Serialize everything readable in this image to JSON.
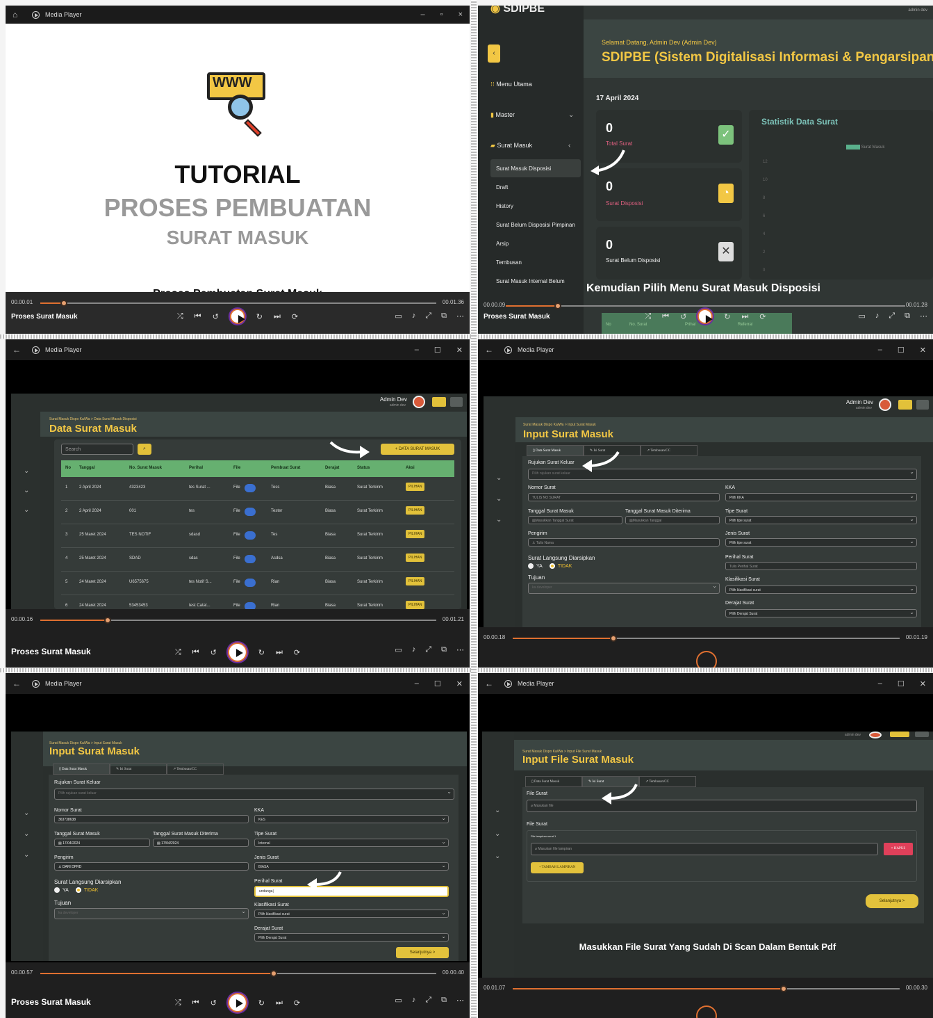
{
  "p1": {
    "title": "Media Player",
    "www_label": "WWW",
    "heading1": "TUTORIAL",
    "heading2": "PROSES PEMBUATAN",
    "heading3": "SURAT MASUK",
    "subtitle": "Proses Pembuatan Surat Masuk",
    "time_start": "00.00.01",
    "time_end": "00.01.36",
    "progress": 0.06,
    "media_title": "Proses Surat Masuk"
  },
  "p2": {
    "logo": "SDIPBE",
    "welcome": "Selamat Datang, Admin Dev (Admin Dev)",
    "app_title": "SDIPBE (Sistem Digitalisasi Informasi & Pengarsipan Berbasis",
    "date": "17 April 2024",
    "top_right": "admin dev",
    "menu": [
      "Menu Utama",
      "Master",
      "Surat Masuk"
    ],
    "submenu": [
      "Surat Masuk Disposisi",
      "Draft",
      "History",
      "Surat Belum Disposisi Pimpinan",
      "Arsip",
      "Tembusan",
      "Surat Masuk Internal Belum"
    ],
    "cards": [
      {
        "value": "0",
        "label": "Total Surat"
      },
      {
        "value": "0",
        "label": "Surat Disposisi"
      },
      {
        "value": "0",
        "label": "Surat Belum Disposisi"
      }
    ],
    "stat_title": "Statistik Data Surat",
    "legend": "Surat Masuk",
    "yticks": [
      "12",
      "10",
      "8",
      "6",
      "4",
      "2",
      "0"
    ],
    "subtitle": "Kemudian Pilih Menu Surat Masuk Disposisi",
    "table_headers": [
      "No",
      "No. Surat",
      "Prihal",
      "Referral"
    ],
    "time_start": "00.00.09",
    "time_end": "00.01.28",
    "progress": 0.13,
    "media_title": "Proses Surat Masuk",
    "colors": {
      "accent": "#f2c744",
      "green_check": "#7cc27c"
    }
  },
  "p3": {
    "title": "Media Player",
    "user": "Admin Dev",
    "user_sub": "admin dev",
    "crumb": "Surat Masuk Dispo Ka/Wa > Data Surat Masuk Disposisi",
    "page_title": "Data Surat Masuk",
    "search_placeholder": "Search",
    "add_button": "+ DATA SURAT MASUK",
    "headers": [
      "No",
      "Tanggal",
      "No. Surat Masuk",
      "Perihal",
      "File",
      "Pembuat Surat",
      "Derajat",
      "Status",
      "Aksi"
    ],
    "rows": [
      [
        "1",
        "2 April 2024",
        "4323423",
        "tes Surat ...",
        "File",
        "Tess",
        "Biasa",
        "Surat Terkirim",
        "PILIHAN"
      ],
      [
        "2",
        "2 April 2024",
        "001",
        "tes",
        "File",
        "Tester",
        "Biasa",
        "Surat Terkirim",
        "PILIHAN"
      ],
      [
        "3",
        "25 Maret 2024",
        "TES NOTIF",
        "sdasd",
        "File",
        "Tes",
        "Biasa",
        "Surat Terkirim",
        "PILIHAN"
      ],
      [
        "4",
        "25 Maret 2024",
        "SDAD",
        "sdas",
        "File",
        "Asdsa",
        "Biasa",
        "Surat Terkirim",
        "PILIHAN"
      ],
      [
        "5",
        "24 Maret 2024",
        "U6575675",
        "tes Notif S...",
        "File",
        "Rian",
        "Biasa",
        "Surat Terkirim",
        "PILIHAN"
      ],
      [
        "6",
        "24 Maret 2024",
        "53453453",
        "test Catat...",
        "File",
        "Rian",
        "Biasa",
        "Surat Terkirim",
        "PILIHAN"
      ]
    ],
    "time_start": "00.00.16",
    "time_end": "00.01.21",
    "progress": 0.17,
    "media_title": "Proses Surat Masuk"
  },
  "p4": {
    "title": "Media Player",
    "user": "Admin Dev",
    "user_sub": "admin dev",
    "crumb": "Surat Masuk Dispo Ka/Wa > Input Surat Masuk",
    "page_title": "Input Surat Masuk",
    "tabs": [
      "Data Surat Masuk",
      "Isi Surat",
      "Tembusan/CC"
    ],
    "rujukan_label": "Rujukan Surat Keluar",
    "rujukan_ph": "Pilih rujukan surat keluar",
    "nomor_label": "Nomor Surat",
    "nomor_ph": "TULIS NO SURAT",
    "tgl_label": "Tanggal Surat Masuk",
    "tgl_ph": "Masukkan Tanggal Surat",
    "tgl2_label": "Tanggal Surat Masuk Diterima",
    "tgl2_ph": "Masukkan Tanggal",
    "pengirim_label": "Pengirim",
    "pengirim_ph": "Tulis Nama",
    "arsip_label": "Surat Langsung Diarsipkan",
    "ya": "YA",
    "tidak": "TIDAK",
    "tujuan_label": "Tujuan",
    "tujuan_ph": "ka developer",
    "kka_label": "KKA",
    "kka_ph": "Pilih KKA",
    "tipe_label": "Tipe Surat",
    "tipe_ph": "Pilih tipe surat",
    "jenis_label": "Jenis Surat",
    "jenis_ph": "Pilih tipe surat",
    "perihal_label": "Perihal Surat",
    "perihal_ph": "Tulis Perihal Surat",
    "klas_label": "Klasifikasi Surat",
    "klas_ph": "Pilih klasifikasi surat",
    "derajat_label": "Derajat Surat",
    "derajat_ph": "Pilih Derajat Surat",
    "time_start": "00.00.18",
    "time_end": "00.01.19",
    "progress": 0.26
  },
  "p5": {
    "title": "Media Player",
    "crumb": "Surat Masuk Dispo Ka/Wa > Input Surat Masuk",
    "page_title": "Input Surat Masuk",
    "tabs": [
      "Data Surat Masuk",
      "Isi Surat",
      "Tembusan/CC"
    ],
    "rujukan_label": "Rujukan Surat Keluar",
    "rujukan_ph": "Pilih rujukan surat keluar",
    "nomor_label": "Nomor Surat",
    "nomor_val": "363738638",
    "tgl_label": "Tanggal Surat Masuk",
    "tgl_val": "17/04/2024",
    "tgl2_label": "Tanggal Surat Masuk Diterima",
    "tgl2_val": "17/04/2024",
    "pengirim_label": "Pengirim",
    "pengirim_val": "DARI DPRD",
    "arsip_label": "Surat Langsung Diarsipkan",
    "ya": "YA",
    "tidak": "TIDAK",
    "tujuan_label": "Tujuan",
    "tujuan_ph": "ka developer",
    "kka_label": "KKA",
    "kka_val": "KES",
    "tipe_label": "Tipe Surat",
    "tipe_val": "Internal",
    "jenis_label": "Jenis Surat",
    "jenis_val": "BIASA",
    "perihal_label": "Perihal Surat",
    "perihal_val": "undanga|",
    "klas_label": "Klasifikasi Surat",
    "klas_ph": "Pilih klasifikasi surat",
    "derajat_label": "Derajat Surat",
    "derajat_ph": "Pilih Derajat Surat",
    "next": "Selanjutnya >",
    "time_start": "00.00.57",
    "time_end": "00.00.40",
    "progress": 0.59,
    "media_title": "Proses Surat Masuk"
  },
  "p6": {
    "title": "Media Player",
    "user_sub": "admin dev",
    "crumb": "Surat Masuk Dispo Ka/Wa > Input File Surat Masuk",
    "page_title": "Input File Surat Masuk",
    "tabs": [
      "Data Surat Masuk",
      "Isi Surat",
      "Tembusan/CC"
    ],
    "file_label": "File Surat",
    "file_ph": "Masukan file",
    "file2_label": "File Surat",
    "lampiran_label": "File lampiran surat 1",
    "lampiran_ph": "Masukan file lampiran",
    "hapus": "× HAPUS",
    "tambah": "+ TAMBAH LAMPIRAN",
    "next": "Selanjutnya >",
    "caption": "Masukkan File Surat Yang Sudah Di Scan Dalam Bentuk Pdf",
    "time_start": "00.01.07",
    "time_end": "00.00.30",
    "progress": 0.7
  }
}
